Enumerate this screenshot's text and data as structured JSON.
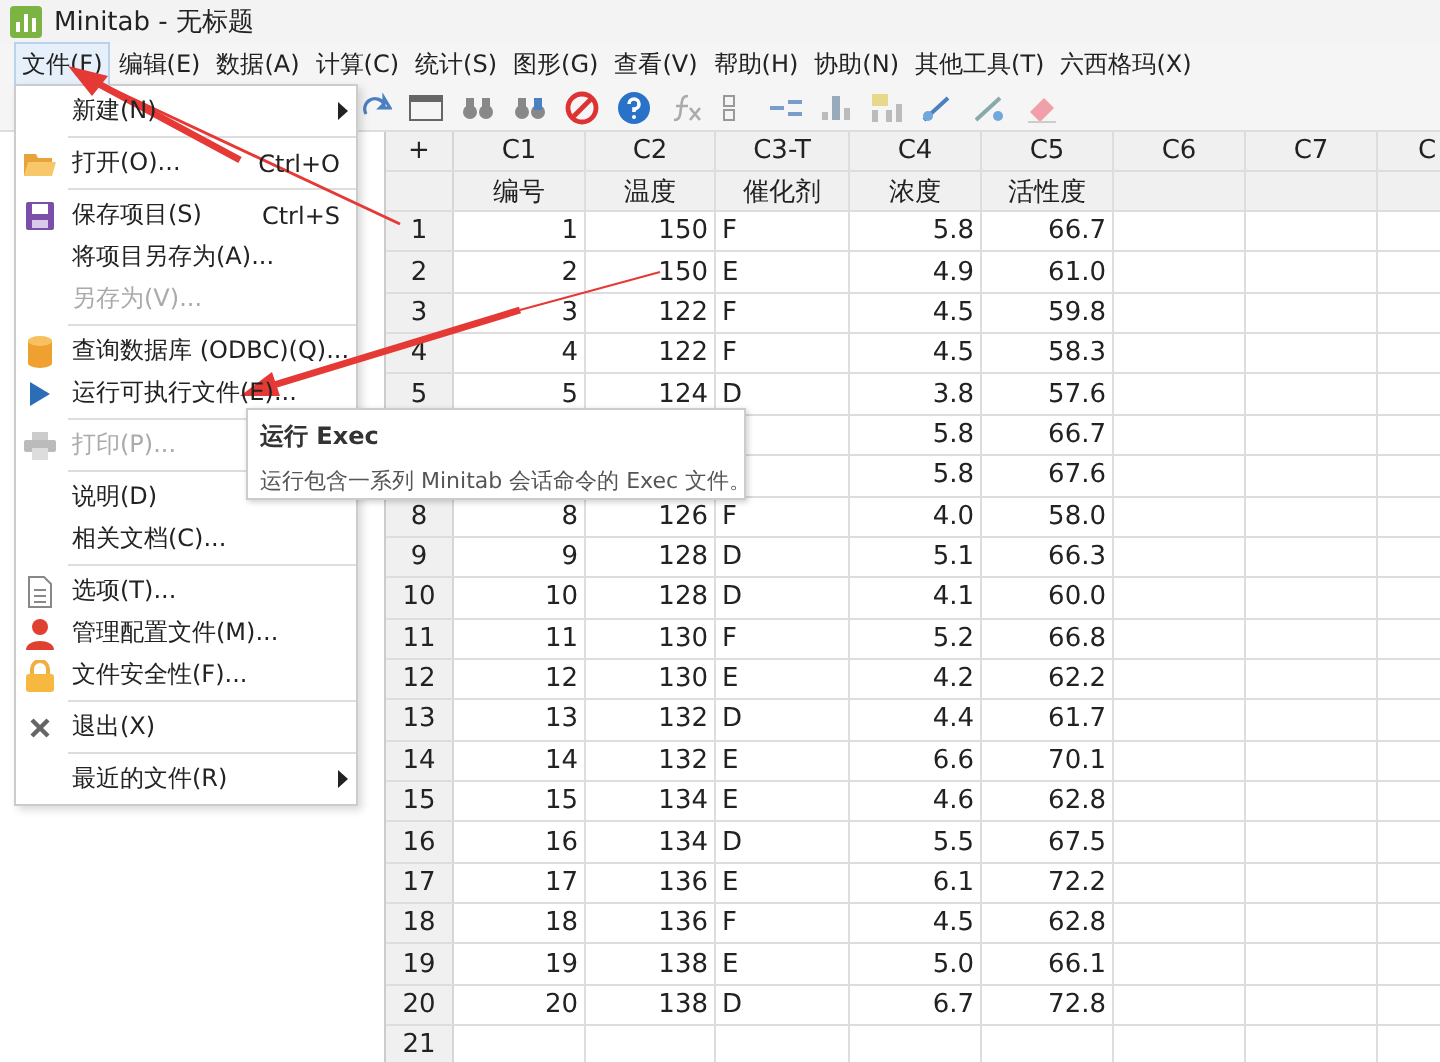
{
  "window": {
    "title": "Minitab - 无标题"
  },
  "menubar": [
    {
      "label": "文件(F)",
      "selected": true
    },
    {
      "label": "编辑(E)",
      "selected": false
    },
    {
      "label": "数据(A)",
      "selected": false
    },
    {
      "label": "计算(C)",
      "selected": false
    },
    {
      "label": "统计(S)",
      "selected": false
    },
    {
      "label": "图形(G)",
      "selected": false
    },
    {
      "label": "查看(V)",
      "selected": false
    },
    {
      "label": "帮助(H)",
      "selected": false
    },
    {
      "label": "协助(N)",
      "selected": false
    },
    {
      "label": "其他工具(T)",
      "selected": false
    },
    {
      "label": "六西格玛(X)",
      "selected": false
    }
  ],
  "file_menu": [
    {
      "kind": "item",
      "label": "新建(N)",
      "submenu": true,
      "disabled": false
    },
    {
      "kind": "separator"
    },
    {
      "kind": "item",
      "label": "打开(O)...",
      "shortcut": "Ctrl+O",
      "disabled": false
    },
    {
      "kind": "separator"
    },
    {
      "kind": "item",
      "label": "保存项目(S)",
      "shortcut": "Ctrl+S",
      "disabled": false
    },
    {
      "kind": "item",
      "label": "将项目另存为(A)...",
      "disabled": false
    },
    {
      "kind": "item",
      "label": "另存为(V)...",
      "disabled": true
    },
    {
      "kind": "separator"
    },
    {
      "kind": "item",
      "label": "查询数据库 (ODBC)(Q)...",
      "disabled": false
    },
    {
      "kind": "item",
      "label": "运行可执行文件(E)...",
      "disabled": false
    },
    {
      "kind": "separator"
    },
    {
      "kind": "item",
      "label": "打印(P)...",
      "disabled": true
    },
    {
      "kind": "separator"
    },
    {
      "kind": "item",
      "label": "说明(D)",
      "disabled": false
    },
    {
      "kind": "item",
      "label": "相关文档(C)...",
      "disabled": false
    },
    {
      "kind": "separator"
    },
    {
      "kind": "item",
      "label": "选项(T)...",
      "disabled": false
    },
    {
      "kind": "item",
      "label": "管理配置文件(M)...",
      "disabled": false
    },
    {
      "kind": "item",
      "label": "文件安全性(F)...",
      "disabled": false
    },
    {
      "kind": "separator"
    },
    {
      "kind": "item",
      "label": "退出(X)",
      "disabled": false
    },
    {
      "kind": "separator"
    },
    {
      "kind": "item",
      "label": "最近的文件(R)",
      "submenu": true,
      "disabled": false
    }
  ],
  "tooltip": {
    "title": "运行 Exec",
    "text": "运行包含一系列 Minitab 会话命令的 Exec 文件。"
  },
  "worksheet": {
    "corner": "+",
    "columns": [
      {
        "id": "C1",
        "name": "编号"
      },
      {
        "id": "C2",
        "name": "温度"
      },
      {
        "id": "C3-T",
        "name": "催化剂"
      },
      {
        "id": "C4",
        "name": "浓度"
      },
      {
        "id": "C5",
        "name": "活性度"
      },
      {
        "id": "C6"
      },
      {
        "id": "C7"
      },
      {
        "id": "C"
      }
    ],
    "rows": [
      {
        "number": "1",
        "cells": [
          "1",
          "150",
          "F",
          "5.8",
          "66.7"
        ]
      },
      {
        "number": "2",
        "cells": [
          "2",
          "150",
          "E",
          "4.9",
          "61.0"
        ]
      },
      {
        "number": "3",
        "cells": [
          "3",
          "122",
          "F",
          "4.5",
          "59.8"
        ]
      },
      {
        "number": "4",
        "cells": [
          "4",
          "122",
          "F",
          "4.5",
          "58.3"
        ]
      },
      {
        "number": "5",
        "cells": [
          "5",
          "124",
          "D",
          "3.8",
          "57.6"
        ]
      },
      {
        "cells": [
          null,
          null,
          null,
          "5.8",
          "66.7"
        ]
      },
      {
        "cells": [
          null,
          null,
          null,
          "5.8",
          "67.6"
        ]
      },
      {
        "number": "8",
        "cells": [
          "8",
          "126",
          "F",
          "4.0",
          "58.0"
        ]
      },
      {
        "number": "9",
        "cells": [
          "9",
          "128",
          "D",
          "5.1",
          "66.3"
        ]
      },
      {
        "number": "10",
        "cells": [
          "10",
          "128",
          "D",
          "4.1",
          "60.0"
        ]
      },
      {
        "number": "11",
        "cells": [
          "11",
          "130",
          "F",
          "5.2",
          "66.8"
        ]
      },
      {
        "number": "12",
        "cells": [
          "12",
          "130",
          "E",
          "4.2",
          "62.2"
        ]
      },
      {
        "number": "13",
        "cells": [
          "13",
          "132",
          "D",
          "4.4",
          "61.7"
        ]
      },
      {
        "number": "14",
        "cells": [
          "14",
          "132",
          "E",
          "6.6",
          "70.1"
        ]
      },
      {
        "number": "15",
        "cells": [
          "15",
          "134",
          "E",
          "4.6",
          "62.8"
        ]
      },
      {
        "number": "16",
        "cells": [
          "16",
          "134",
          "D",
          "5.5",
          "67.5"
        ]
      },
      {
        "number": "17",
        "cells": [
          "17",
          "136",
          "E",
          "6.1",
          "72.2"
        ]
      },
      {
        "number": "18",
        "cells": [
          "18",
          "136",
          "F",
          "4.5",
          "62.8"
        ]
      },
      {
        "number": "19",
        "cells": [
          "19",
          "138",
          "E",
          "5.0",
          "66.1"
        ]
      },
      {
        "number": "20",
        "cells": [
          "20",
          "138",
          "D",
          "6.7",
          "72.8"
        ]
      },
      {
        "number": "21",
        "cells": []
      }
    ]
  }
}
